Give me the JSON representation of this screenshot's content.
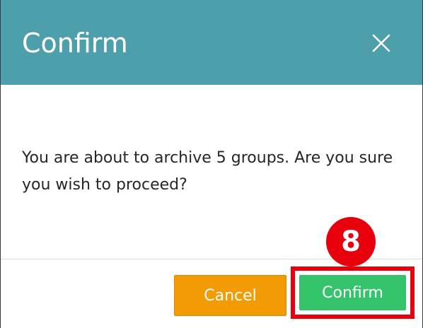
{
  "dialog": {
    "title": "Confirm",
    "close_icon": "close-icon",
    "message": "You are about to archive 5 groups. Are you sure you wish to proceed?",
    "buttons": {
      "cancel_label": "Cancel",
      "confirm_label": "Confirm"
    }
  },
  "annotation": {
    "step_number": "8"
  },
  "colors": {
    "header_bg": "#4d9fab",
    "cancel_bg": "#f29b05",
    "confirm_bg": "#35c46b",
    "highlight": "#e8000c"
  }
}
